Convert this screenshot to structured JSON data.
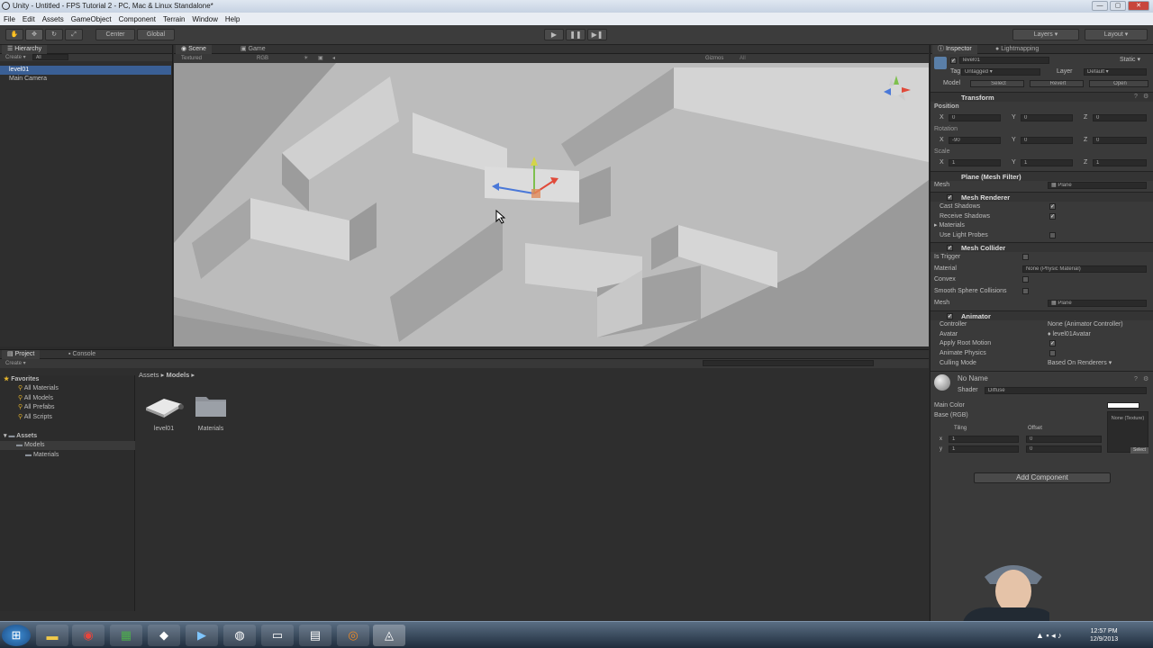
{
  "window": {
    "title": "Unity - Untitled - FPS Tutorial 2 - PC, Mac & Linux Standalone*",
    "controls": [
      "—",
      "▢",
      "✕"
    ]
  },
  "menu": [
    "File",
    "Edit",
    "Assets",
    "GameObject",
    "Component",
    "Terrain",
    "Window",
    "Help"
  ],
  "toolbar": {
    "pivot_mode": "Center",
    "pivot_space": "Global",
    "layers_label": "Layers",
    "layout_label": "Layout"
  },
  "hierarchy": {
    "tab": "Hierarchy",
    "create_label": "Create",
    "search_placeholder": "All",
    "items": [
      {
        "name": "level01",
        "selected": true
      },
      {
        "name": "Main Camera",
        "selected": false
      }
    ]
  },
  "scene": {
    "tabs": [
      "Scene",
      "Game"
    ],
    "render_mode": "Textured",
    "color_mode": "RGB",
    "gizmos_label": "Gizmos",
    "gizmos_search": "All"
  },
  "inspector": {
    "tabs": [
      "Inspector",
      "Lightmapping"
    ],
    "object_name": "level01",
    "static_label": "Static",
    "tag_label": "Tag",
    "tag_value": "Untagged",
    "layer_label": "Layer",
    "layer_value": "Default",
    "model_label": "Model",
    "model_buttons": [
      "Select",
      "Revert",
      "Open"
    ],
    "transform": {
      "title": "Transform",
      "position_label": "Position",
      "rotation_label": "Rotation",
      "scale_label": "Scale",
      "position": {
        "x": "0",
        "y": "0",
        "z": "0"
      },
      "rotation": {
        "x": "-90",
        "y": "0",
        "z": "0"
      },
      "scale": {
        "x": "1",
        "y": "1",
        "z": "1"
      }
    },
    "mesh_filter": {
      "title": "Plane (Mesh Filter)",
      "mesh_label": "Mesh",
      "mesh_value": "Plane"
    },
    "mesh_renderer": {
      "title": "Mesh Renderer",
      "cast_shadows": "Cast Shadows",
      "receive_shadows": "Receive Shadows",
      "materials": "Materials",
      "use_light_probes": "Use Light Probes"
    },
    "mesh_collider": {
      "title": "Mesh Collider",
      "is_trigger": "Is Trigger",
      "material_label": "Material",
      "material_value": "None (Physic Material)",
      "convex": "Convex",
      "smooth": "Smooth Sphere Collisions",
      "mesh_label": "Mesh",
      "mesh_value": "Plane"
    },
    "animator": {
      "title": "Animator",
      "controller_label": "Controller",
      "controller_value": "None (Animator Controller)",
      "avatar_label": "Avatar",
      "avatar_value": "level01Avatar",
      "apply_root": "Apply Root Motion",
      "animate_physics": "Animate Physics",
      "culling_label": "Culling Mode",
      "culling_value": "Based On Renderers"
    },
    "material": {
      "name": "No Name",
      "shader_label": "Shader",
      "shader_value": "Diffuse",
      "main_color": "Main Color",
      "base_rgb": "Base (RGB)",
      "tiling": "Tiling",
      "offset": "Offset",
      "tiling_x": "1",
      "tiling_y": "1",
      "offset_x": "0",
      "offset_y": "0",
      "texture_none": "None (Texture)",
      "select": "Select"
    },
    "add_component": "Add Component"
  },
  "project": {
    "tabs": [
      "Project",
      "Console"
    ],
    "create_label": "Create",
    "breadcrumb": [
      "Assets",
      "Models"
    ],
    "favorites_label": "Favorites",
    "favorites": [
      "All Materials",
      "All Models",
      "All Prefabs",
      "All Scripts"
    ],
    "assets_label": "Assets",
    "tree": [
      "Models",
      "Materials"
    ],
    "items": [
      {
        "name": "level01",
        "type": "model"
      },
      {
        "name": "Materials",
        "type": "folder"
      }
    ]
  },
  "taskbar": {
    "time": "12:57 PM",
    "date": "12/9/2013"
  },
  "colors": {
    "selection": "#3a5f95",
    "panel": "#2e2e2e",
    "scene_bg": "#9a9a9a"
  }
}
